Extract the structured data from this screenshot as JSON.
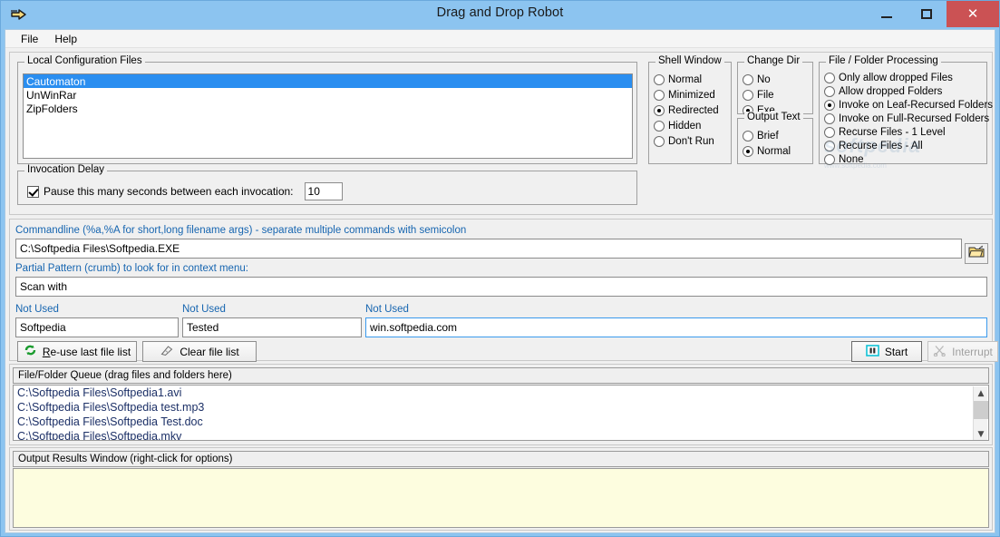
{
  "window": {
    "title": "Drag and Drop Robot",
    "icon": "drag-drop-arrow-icon",
    "minimize_label": "–",
    "maximize_label": "□",
    "close_label": "✕"
  },
  "menubar": {
    "items": [
      {
        "label": "File"
      },
      {
        "label": "Help"
      }
    ]
  },
  "local_config": {
    "legend": "Local Configuration Files",
    "items": [
      {
        "label": "Cautomaton",
        "selected": true
      },
      {
        "label": "UnWinRar",
        "selected": false
      },
      {
        "label": "ZipFolders",
        "selected": false
      }
    ]
  },
  "invocation_delay": {
    "legend": "Invocation Delay",
    "checkbox_label": "Pause this many seconds between each invocation:",
    "checked": true,
    "seconds_value": "10"
  },
  "shell_window": {
    "legend": "Shell Window",
    "options": [
      {
        "label": "Normal",
        "selected": false
      },
      {
        "label": "Minimized",
        "selected": false
      },
      {
        "label": "Redirected",
        "selected": true
      },
      {
        "label": "Hidden",
        "selected": false
      },
      {
        "label": "Don't Run",
        "selected": false
      }
    ]
  },
  "change_dir": {
    "legend": "Change Dir",
    "options": [
      {
        "label": "No",
        "selected": false
      },
      {
        "label": "File",
        "selected": false
      },
      {
        "label": "Exe",
        "selected": true
      }
    ]
  },
  "output_text": {
    "legend": "Output Text",
    "options": [
      {
        "label": "Brief",
        "selected": false
      },
      {
        "label": "Normal",
        "selected": true
      }
    ]
  },
  "file_folder_processing": {
    "legend": "File / Folder Processing",
    "options": [
      {
        "label": "Only allow dropped Files",
        "selected": false
      },
      {
        "label": "Allow dropped Folders",
        "selected": false
      },
      {
        "label": "Invoke on Leaf-Recursed Folders",
        "selected": true
      },
      {
        "label": "Invoke on Full-Recursed Folders",
        "selected": false
      },
      {
        "label": "Recurse Files - 1 Level",
        "selected": false
      },
      {
        "label": "Recurse Files - All",
        "selected": false
      },
      {
        "label": "None",
        "selected": false
      }
    ]
  },
  "watermark": {
    "text": "softpedia",
    "sub": "www.softpedia.com"
  },
  "commandline": {
    "label": "Commandline (%a,%A for short,long filename args) - separate multiple commands with semicolon",
    "value": "C:\\Softpedia Files\\Softpedia.EXE",
    "browse_icon": "open-folder-icon"
  },
  "partial_pattern": {
    "label": "Partial Pattern (crumb) to look for in context menu:",
    "value": "Scan with"
  },
  "extra_fields": [
    {
      "label": "Not Used",
      "value": "Softpedia",
      "focused": false
    },
    {
      "label": "Not Used",
      "value": "Tested",
      "focused": false
    },
    {
      "label": "Not Used",
      "value": "win.softpedia.com",
      "focused": true
    }
  ],
  "actions": {
    "reuse_accel": "R",
    "reuse_rest": "e-use last file list",
    "reuse_icon": "recycle-refresh-icon",
    "clear_label": "Clear file list",
    "clear_icon": "eraser-icon",
    "start_label": "Start",
    "start_icon": "pause-start-icon",
    "interrupt_label": "Interrupt",
    "interrupt_icon": "scissors-icon",
    "interrupt_disabled": true
  },
  "queue": {
    "header": "File/Folder Queue (drag files and folders here)",
    "items": [
      {
        "path": "C:\\Softpedia Files\\Softpedia1.avi"
      },
      {
        "path": "C:\\Softpedia Files\\Softpedia test.mp3"
      },
      {
        "path": "C:\\Softpedia Files\\Softpedia Test.doc"
      },
      {
        "path": "C:\\Softpedia Files\\Softpedia.mkv"
      }
    ],
    "scroll_up": "▲",
    "scroll_down": "▼"
  },
  "output": {
    "header": "Output Results Window (right-click for options)",
    "content": ""
  },
  "colors": {
    "title_bar": "#8cc4f0",
    "close_button": "#cb5254",
    "selection": "#2a8ef0",
    "label_link": "#1665b0",
    "output_bg": "#fdfddf",
    "queue_text": "#1b2f66"
  }
}
